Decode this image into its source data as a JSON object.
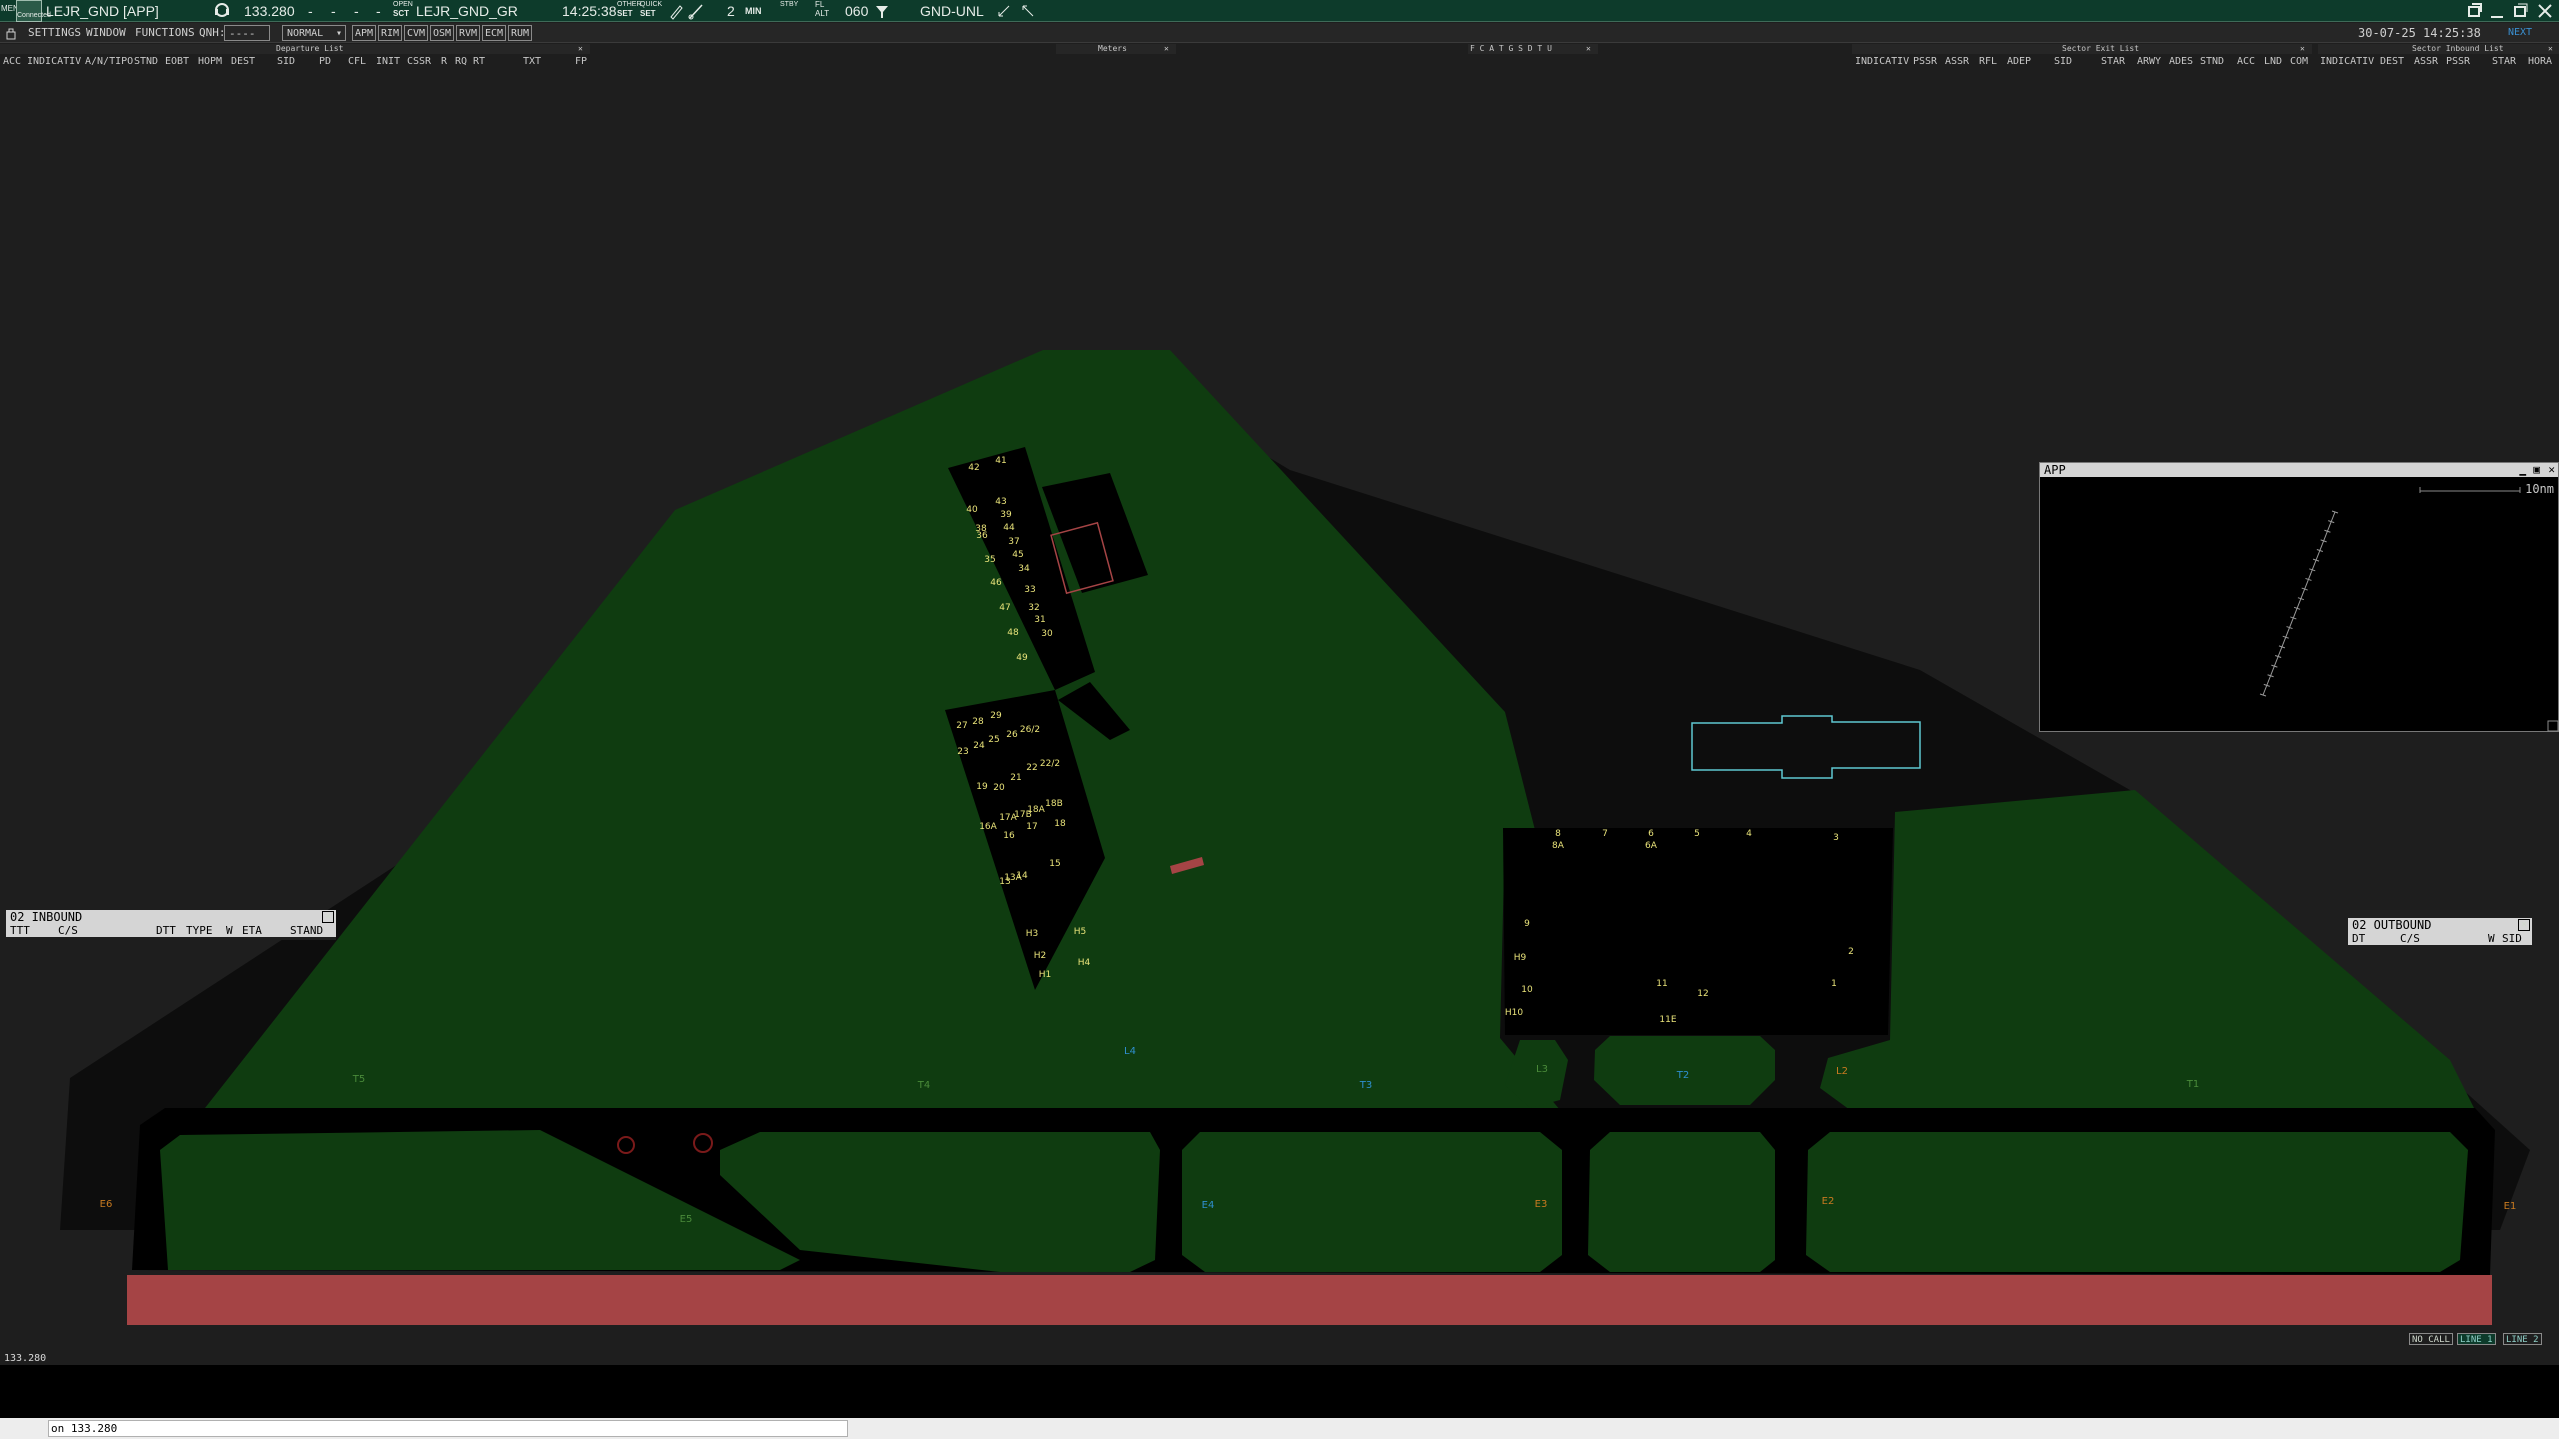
{
  "topbar": {
    "menu_label": "MENU",
    "conn_status": "Connected",
    "callsign": "LEJR_GND [APP]",
    "frequency": "133.280",
    "freq_dashes": [
      "-",
      "-",
      "-",
      "-"
    ],
    "open_label": "OPEN",
    "sct_label": "SCT",
    "sector_name": "LEJR_GND_GR",
    "clock": "14:25:38",
    "other_label": "OTHER",
    "quick_label": "QUICK",
    "set_label": "SET",
    "min_value": "2",
    "min_label": "MIN",
    "stby_label": "STBY",
    "fl_label": "FL",
    "alt_label": "ALT",
    "heading": "060",
    "sector_filter": "GND-UNL"
  },
  "datetime": "30-07-25 14:25:38",
  "topright_label": "NEXT",
  "menubar": {
    "settings": "SETTINGS",
    "window": "WINDOW",
    "functions": "FUNCTIONS",
    "qnh_label": "QNH:",
    "qnh_value": "----",
    "mode": "NORMAL",
    "buttons": [
      "APM",
      "RIM",
      "CVM",
      "OSM",
      "RVM",
      "ECM",
      "RUM"
    ]
  },
  "panels": {
    "departure": {
      "title": "Departure List",
      "columns": [
        "ACC",
        "INDICATIV",
        "A/N/TIPO",
        "STND",
        "EOBT",
        "HOPM",
        "DEST",
        "SID",
        "PD",
        "CFL",
        "INIT",
        "CSSR",
        "R",
        "RQ",
        "RT",
        "TXT",
        "FP"
      ]
    },
    "meters": {
      "title": "Meters"
    },
    "flags": {
      "title": "F C A T G S D T U"
    },
    "sector_exit": {
      "title": "Sector Exit List",
      "columns": [
        "INDICATIV",
        "PSSR",
        "ASSR",
        "RFL",
        "ADEP",
        "SID",
        "STAR",
        "ARWY",
        "ADES",
        "STND",
        "ACC",
        "LND",
        "COM"
      ]
    },
    "sector_inbound": {
      "title": "Sector Inbound List",
      "columns": [
        "INDICATIV",
        "DEST",
        "ASSR",
        "PSSR",
        "STAR",
        "HORA"
      ]
    }
  },
  "inbound": {
    "title": "02 INBOUND",
    "columns": [
      "TTT",
      "C/S",
      "DTT",
      "TYPE",
      "W",
      "ETA",
      "STAND"
    ]
  },
  "outbound": {
    "title": "02 OUTBOUND",
    "columns": [
      "DT",
      "C/S",
      "W",
      "SID"
    ]
  },
  "app_window": {
    "title": "APP",
    "scale": "10nm"
  },
  "map": {
    "stands_pier": [
      "41",
      "42",
      "43",
      "40",
      "39",
      "38",
      "44",
      "37",
      "36",
      "45",
      "35",
      "34",
      "46",
      "33",
      "47",
      "32",
      "31",
      "48",
      "30",
      "49",
      "29",
      "27",
      "28",
      "26/2",
      "26",
      "25",
      "24",
      "23",
      "22/2",
      "22",
      "21",
      "20",
      "19",
      "18B",
      "18A",
      "17B",
      "17A",
      "18",
      "16A",
      "16",
      "17",
      "15",
      "13A",
      "14",
      "13",
      "H3",
      "H5",
      "H2",
      "H4",
      "H1"
    ],
    "stands_apron": [
      "8",
      "7",
      "6",
      "5",
      "4",
      "3",
      "8A",
      "6A",
      "9",
      "H9",
      "2",
      "1",
      "10",
      "11",
      "12",
      "H10",
      "11E"
    ],
    "taxiway_labels": [
      "T5",
      "T4",
      "T3",
      "T2",
      "T1",
      "L4",
      "L3",
      "L2",
      "E6",
      "E5",
      "E4",
      "E3",
      "E2",
      "E1"
    ],
    "colors": {
      "grass": "#0f3c10",
      "runway": "#a54445",
      "asphalt": "#000000",
      "background": "#1e1e1e",
      "stand_text": "#e9e37a",
      "blue_label": "#2f8fcf",
      "orange_label": "#c87a20",
      "green_label": "#4a8a3a",
      "outline": "#5fc8d2"
    }
  },
  "status": {
    "left_freq": "133.280",
    "no_call": "NO CALL",
    "line1": "LINE 1",
    "line2": "LINE 2"
  },
  "command": {
    "text": "on 133.280"
  }
}
